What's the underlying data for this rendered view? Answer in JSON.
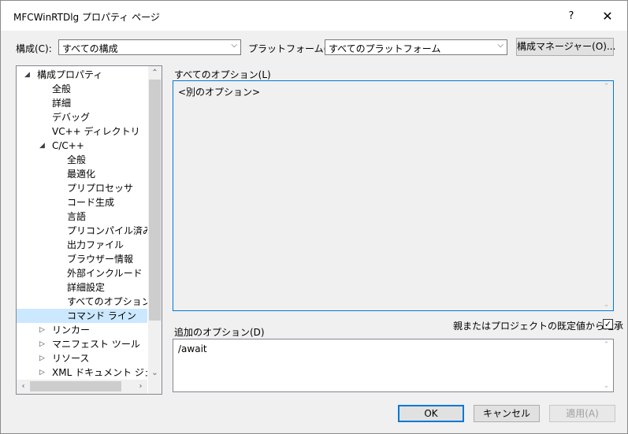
{
  "window": {
    "title": "MFCWinRTDlg プロパティ ページ",
    "help": "?",
    "close": "✕"
  },
  "config": {
    "label": "構成(C):",
    "value": "すべての構成"
  },
  "platform": {
    "label": "プラットフォーム(P):",
    "value": "すべてのプラットフォーム"
  },
  "config_manager": "構成マネージャー(O)...",
  "tree": {
    "items": [
      {
        "label": "構成プロパティ",
        "indent": 0,
        "expander": "◢"
      },
      {
        "label": "全般",
        "indent": 1
      },
      {
        "label": "詳細",
        "indent": 1
      },
      {
        "label": "デバッグ",
        "indent": 1
      },
      {
        "label": "VC++ ディレクトリ",
        "indent": 1
      },
      {
        "label": "C/C++",
        "indent": 1,
        "expander": "◢"
      },
      {
        "label": "全般",
        "indent": 2
      },
      {
        "label": "最適化",
        "indent": 2
      },
      {
        "label": "プリプロセッサ",
        "indent": 2
      },
      {
        "label": "コード生成",
        "indent": 2
      },
      {
        "label": "言語",
        "indent": 2
      },
      {
        "label": "プリコンパイル済みヘッ",
        "indent": 2
      },
      {
        "label": "出力ファイル",
        "indent": 2
      },
      {
        "label": "ブラウザー情報",
        "indent": 2
      },
      {
        "label": "外部インクルード",
        "indent": 2
      },
      {
        "label": "詳細設定",
        "indent": 2
      },
      {
        "label": "すべてのオプション",
        "indent": 2
      },
      {
        "label": "コマンド ライン",
        "indent": 2,
        "selected": true
      },
      {
        "label": "リンカー",
        "indent": 1,
        "expander": "▷"
      },
      {
        "label": "マニフェスト ツール",
        "indent": 1,
        "expander": "▷"
      },
      {
        "label": "リソース",
        "indent": 1,
        "expander": "▷"
      },
      {
        "label": "XML ドキュメント ジェネレー",
        "indent": 1,
        "expander": "▷"
      }
    ]
  },
  "all_options": {
    "label": "すべてのオプション(L)",
    "value": "<別のオプション>"
  },
  "inherit": {
    "label": "親またはプロジェクトの既定値から継承",
    "checked": true
  },
  "additional": {
    "label": "追加のオプション(D)",
    "value": "/await"
  },
  "buttons": {
    "ok": "OK",
    "cancel": "キャンセル",
    "apply": "適用(A)"
  },
  "colors": {
    "selection": "#cce8ff",
    "accent": "#0078d7"
  }
}
